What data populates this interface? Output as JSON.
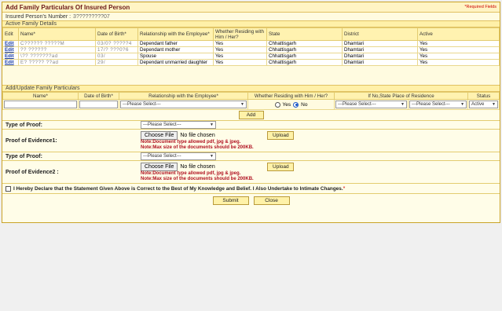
{
  "header": {
    "title": "Add Family Particulars Of Insured Person",
    "required_note": "*Required Fields"
  },
  "insured": {
    "label": "Insured Person's Number :",
    "value": "3?????????07"
  },
  "active_section": "Active Family Details",
  "family_table": {
    "headers": [
      "Edit",
      "Name*",
      "Date of Birth*",
      "Relationship with the Employee*",
      "Whether Residing with Him / Her?",
      "State",
      "District",
      "Active"
    ],
    "rows": [
      {
        "edit": "Edit",
        "name": "C?????? ?????M",
        "dob": "03/0? ?????4",
        "relation": "Dependant father",
        "residing": "Yes",
        "state": "Chhattisgarh",
        "district": "Dhamtari",
        "active": "Yes"
      },
      {
        "edit": "Edit",
        "name": "?? ??????",
        "dob": "17/? ???0?6",
        "relation": "Dependant mother",
        "residing": "Yes",
        "state": "Chhattisgarh",
        "district": "Dhamtari",
        "active": "Yes"
      },
      {
        "edit": "Edit",
        "name": "\\?? ???????ad",
        "dob": "03/",
        "relation": "Spouse",
        "residing": "Yes",
        "state": "Chhattisgarh",
        "district": "Dhamtari",
        "active": "Yes"
      },
      {
        "edit": "Edit",
        "name": "E? ????? ??ad",
        "dob": "29/",
        "relation": "Dependant unmarried daughter",
        "residing": "Yes",
        "state": "Chhattisgarh",
        "district": "Dhamtari",
        "active": "Yes"
      }
    ]
  },
  "update_section": "Add/Update Family Particulars",
  "update_table": {
    "headers": [
      "Name*",
      "Date of Birth*",
      "Relationship with the Employee*",
      "Whether Residing with Him / Her?",
      "If No,State Place of Residence",
      "Status"
    ],
    "relation_select": "---Please Select---",
    "yes_label": "Yes",
    "no_label": "No",
    "state_select": "---Please Select---",
    "district_select": "---Please Select---",
    "status_select": "Active"
  },
  "add_button": "Add",
  "proof1": {
    "type_label": "Type of Proof:",
    "type_select": "---Please Select---",
    "evidence_label": "Proof of Evidence1:",
    "choose": "Choose File",
    "nofile": "No file chosen",
    "upload": "Upload",
    "note1": "Note:Document type allowed pdf, jpg & jpeg.",
    "note2": "Note:Max size of the documents should be 200KB."
  },
  "proof2": {
    "type_label": "Type of Proof:",
    "type_select": "---Please Select---",
    "evidence_label": "Proof of Evidence2 :",
    "choose": "Choose File",
    "nofile": "No file chosen",
    "upload": "Upload",
    "note1": "Note:Document type allowed pdf, jpg & jpeg.",
    "note2": "Note:Max size of the documents should be 200KB."
  },
  "declaration": "I Hereby Declare that the Statement Given Above is Correct to the Best of My Knowledge and Belief. I Also Undertake to Intimate Changes.",
  "submit_label": "Submit",
  "close_label": "Close"
}
